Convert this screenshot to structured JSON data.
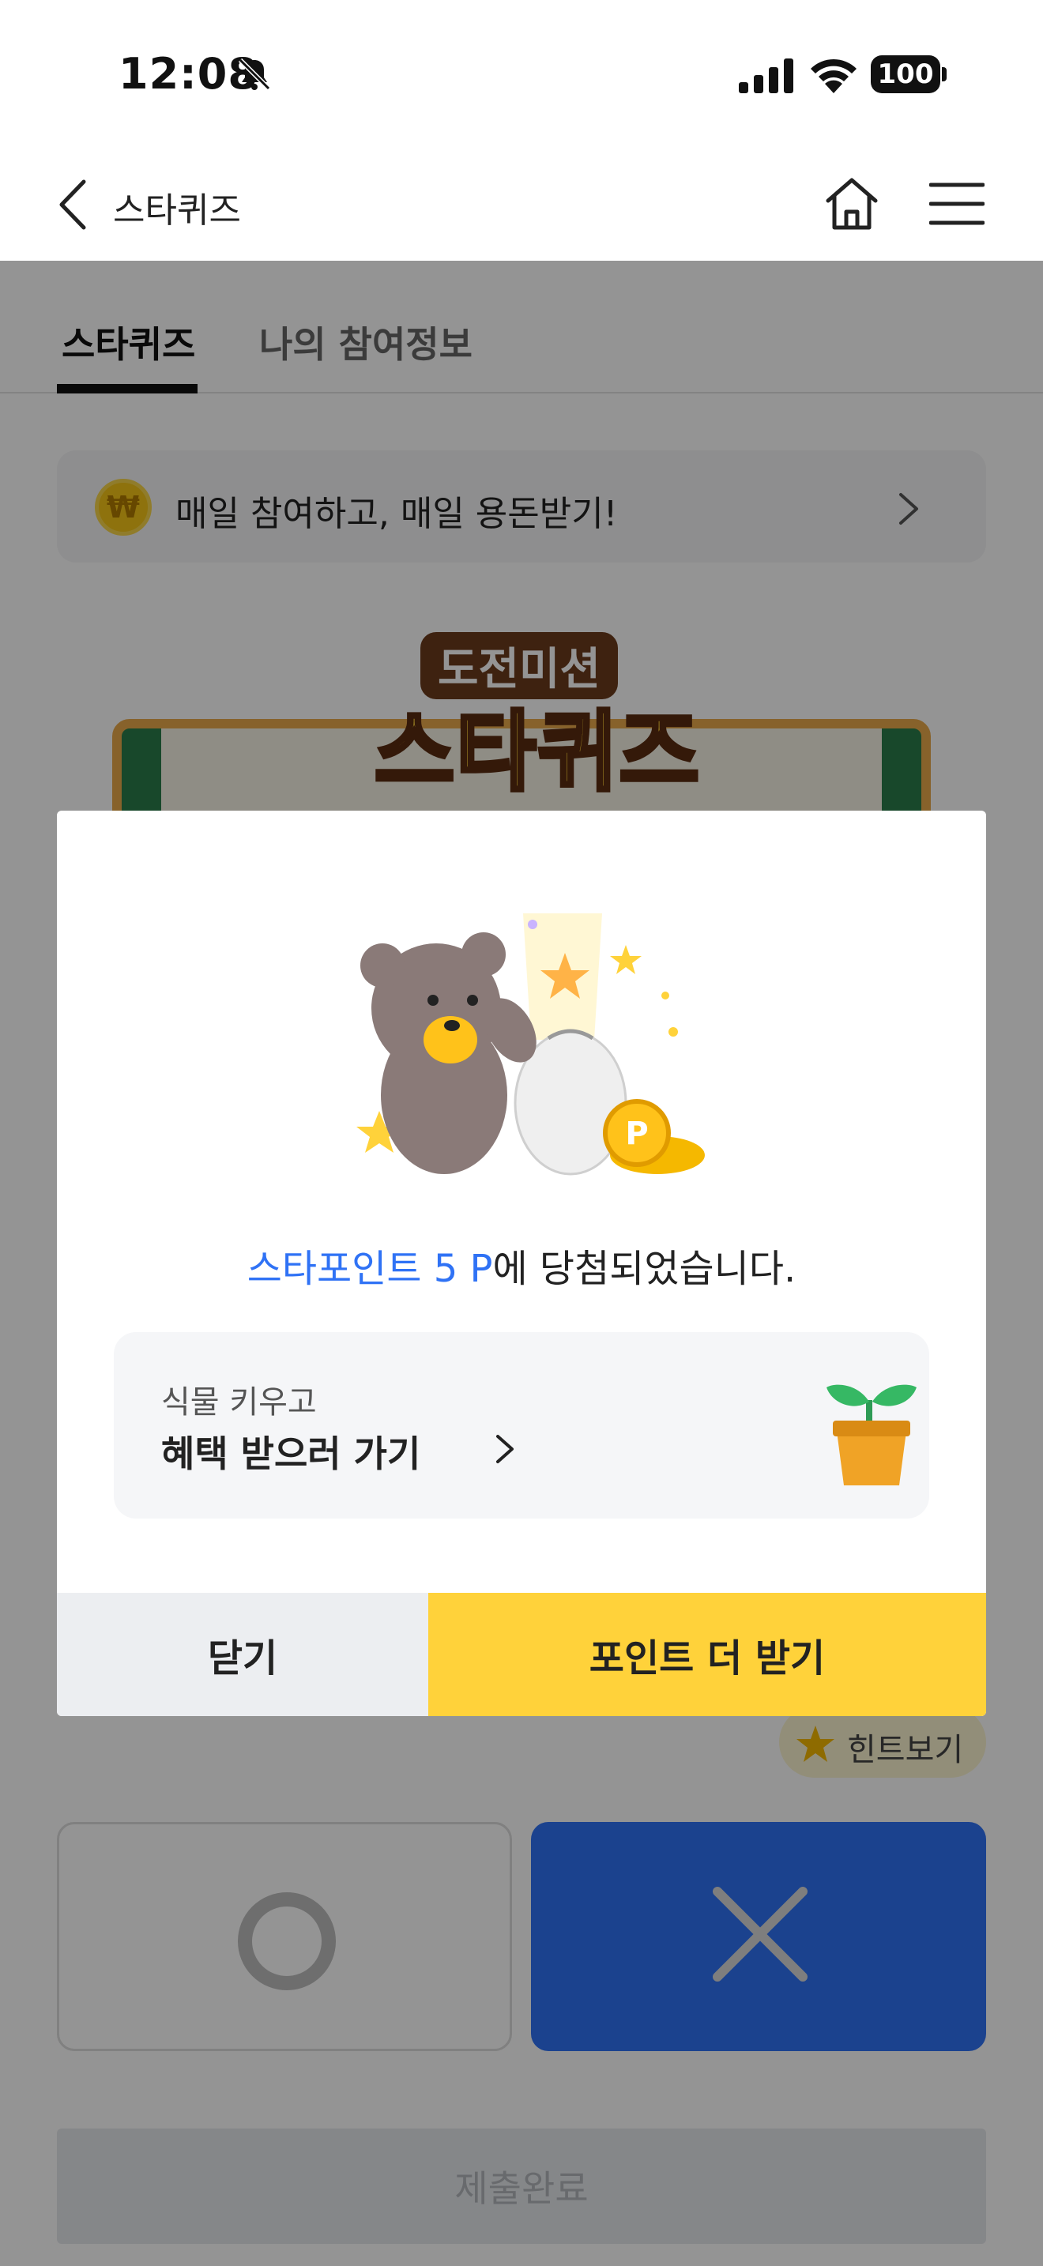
{
  "status_bar": {
    "time": "12:08",
    "battery": "100"
  },
  "header": {
    "title": "스타퀴즈"
  },
  "tabs": [
    {
      "label": "스타퀴즈",
      "active": true
    },
    {
      "label": "나의 참여정보",
      "active": false
    }
  ],
  "promo": {
    "icon_glyph": "₩",
    "text": "매일 참여하고, 매일 용돈받기!"
  },
  "quiz_logo": {
    "subtitle": "도전미션",
    "title": "스타퀴즈"
  },
  "hint": {
    "label": "힌트보기"
  },
  "submit": {
    "label": "제출완료"
  },
  "modal": {
    "result_highlight": "스타포인트 5 P",
    "result_suffix": "에 당첨되었습니다.",
    "benefit": {
      "label": "식물 키우고",
      "link": "혜택 받으러 가기"
    },
    "close_label": "닫기",
    "more_points_label": "포인트 더 받기",
    "coin_glyph": "P"
  },
  "colors": {
    "accent_blue": "#2f72f5",
    "accent_yellow": "#ffd23a"
  }
}
